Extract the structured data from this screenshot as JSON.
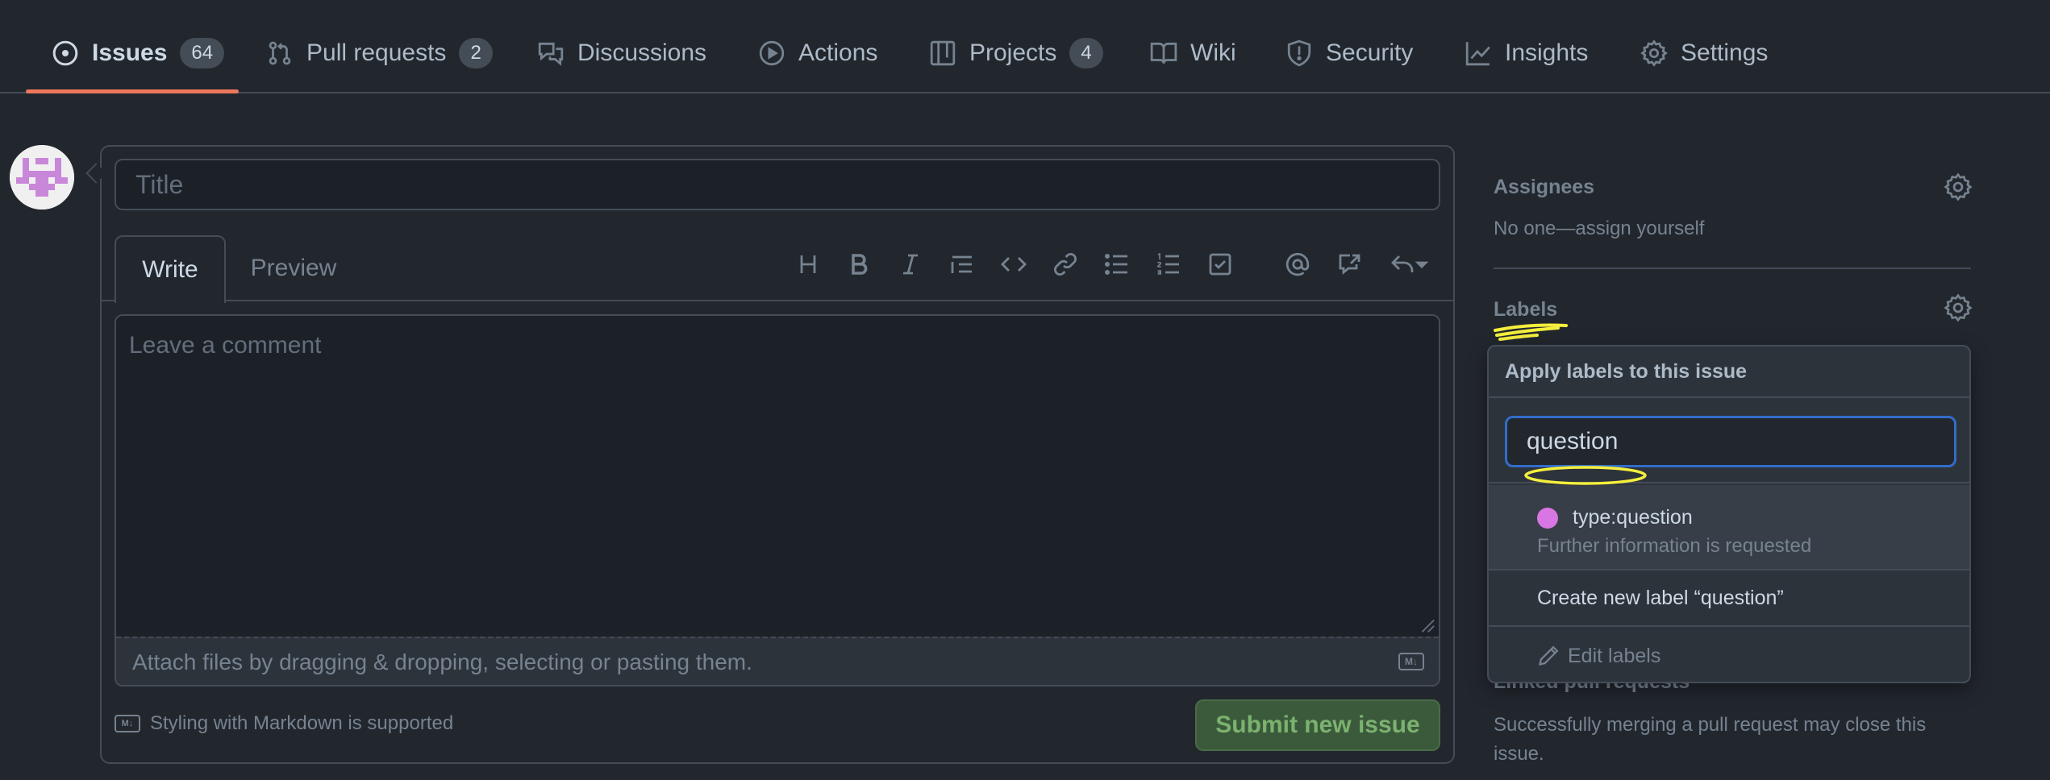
{
  "nav": {
    "items": [
      {
        "label": "Issues",
        "count": "64",
        "icon": "issue-opened-icon"
      },
      {
        "label": "Pull requests",
        "count": "2",
        "icon": "git-pull-request-icon"
      },
      {
        "label": "Discussions",
        "icon": "comment-discussion-icon"
      },
      {
        "label": "Actions",
        "icon": "play-icon"
      },
      {
        "label": "Projects",
        "count": "4",
        "icon": "table-icon"
      },
      {
        "label": "Wiki",
        "icon": "book-icon"
      },
      {
        "label": "Security",
        "icon": "shield-icon"
      },
      {
        "label": "Insights",
        "icon": "graph-icon"
      },
      {
        "label": "Settings",
        "icon": "gear-icon"
      }
    ],
    "active": "Issues"
  },
  "form": {
    "title_placeholder": "Title",
    "tabs": {
      "write": "Write",
      "preview": "Preview"
    },
    "comment_placeholder": "Leave a comment",
    "attach_text": "Attach files by dragging & dropping, selecting or pasting them.",
    "markdown_note": "Styling with Markdown is supported",
    "submit_label": "Submit new issue"
  },
  "sidebar": {
    "assignees": {
      "heading": "Assignees",
      "text": "No one—assign yourself"
    },
    "labels": {
      "heading": "Labels"
    },
    "linked_prs": {
      "heading": "Linked pull requests",
      "text": "Successfully merging a pull request may close this issue."
    }
  },
  "labels_popover": {
    "header": "Apply labels to this issue",
    "filter_value": "question",
    "results": [
      {
        "name": "type:question",
        "description": "Further information is requested",
        "color": "#d876e3"
      }
    ],
    "create_label": "Create new label “question”",
    "edit_labels": "Edit labels"
  },
  "colors": {
    "accent_underline": "#ec775c",
    "focus_border": "#316dca",
    "submit_bg": "#3b5a3b",
    "highlight_marker": "#f5ef3d"
  }
}
